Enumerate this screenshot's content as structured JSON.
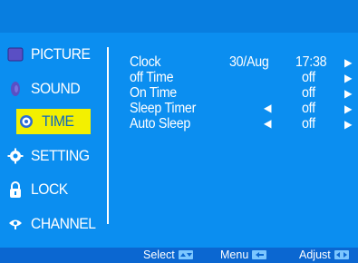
{
  "menu": {
    "items": [
      {
        "label": "PICTURE",
        "icon": "picture-icon",
        "active": false
      },
      {
        "label": "SOUND",
        "icon": "sound-icon",
        "active": false
      },
      {
        "label": "TIME",
        "icon": "time-icon",
        "active": true
      },
      {
        "label": "SETTING",
        "icon": "setting-icon",
        "active": false
      },
      {
        "label": "LOCK",
        "icon": "lock-icon",
        "active": false
      },
      {
        "label": "CHANNEL",
        "icon": "channel-icon",
        "active": false
      }
    ]
  },
  "options": {
    "clock": {
      "label": "Clock",
      "date": "30/Aug",
      "value": "17:38"
    },
    "off_time": {
      "label": "off Time",
      "value": "off"
    },
    "on_time": {
      "label": "On Time",
      "value": "off"
    },
    "sleep_timer": {
      "label": "Sleep Timer",
      "value": "off"
    },
    "auto_sleep": {
      "label": "Auto Sleep",
      "value": "off"
    }
  },
  "footer": {
    "select": "Select",
    "menu": "Menu",
    "adjust": "Adjust"
  },
  "colors": {
    "background": "#0b8ef0",
    "highlight": "#f3f000",
    "footer": "#0b67d1"
  }
}
